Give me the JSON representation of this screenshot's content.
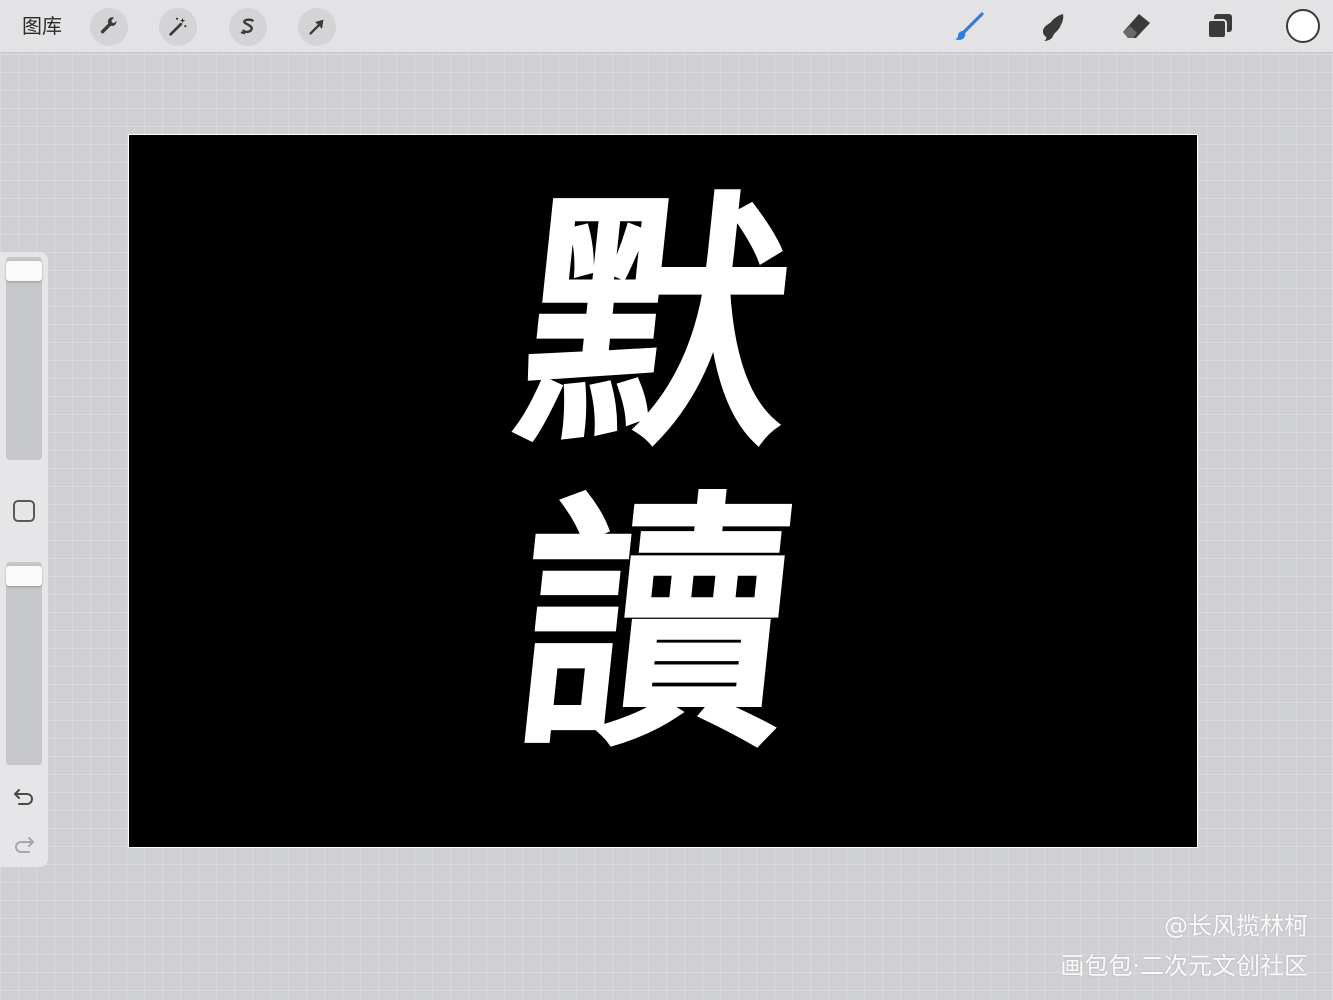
{
  "toolbar": {
    "gallery_label": "图库",
    "left_tools": [
      {
        "name": "actions",
        "icon": "wrench-icon"
      },
      {
        "name": "adjustments",
        "icon": "magic-wand-icon"
      },
      {
        "name": "selection",
        "icon": "selection-s-icon"
      },
      {
        "name": "transform",
        "icon": "arrow-cursor-icon"
      }
    ],
    "right_tools": [
      {
        "name": "brush",
        "icon": "brush-icon",
        "active": true
      },
      {
        "name": "smudge",
        "icon": "smudge-finger-icon"
      },
      {
        "name": "eraser",
        "icon": "eraser-icon"
      },
      {
        "name": "layers",
        "icon": "layers-icon"
      }
    ],
    "current_color": "#ffffff",
    "accent_color": "#2f7de1"
  },
  "canvas": {
    "background": "#000000",
    "artwork_chars": [
      "默",
      "讀"
    ]
  },
  "sidebar": {
    "brush_size_level": 0.02,
    "opacity_level": 0.02,
    "icons": [
      "modify-square-icon",
      "undo-icon",
      "redo-icon"
    ]
  },
  "watermark": {
    "line1": "@长风揽林柯",
    "line2": "画包包·二次元文创社区"
  }
}
